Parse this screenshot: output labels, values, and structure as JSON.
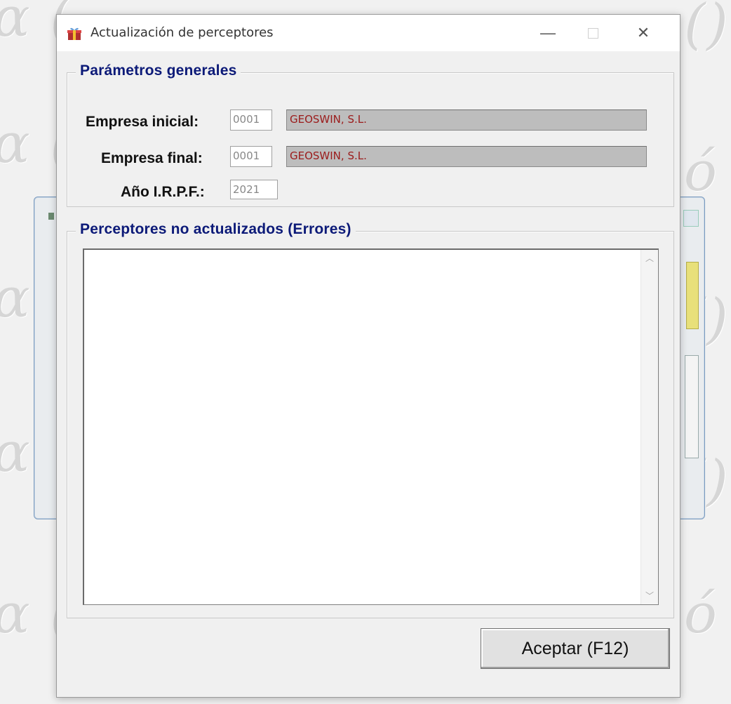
{
  "window": {
    "title": "Actualización de perceptores",
    "minimize_icon": "minimize-icon",
    "maximize_icon": "maximize-icon",
    "close_icon": "close-icon",
    "app_icon": "gift-box-icon"
  },
  "general_params": {
    "legend": "Parámetros generales",
    "empresa_inicial_label": "Empresa inicial:",
    "empresa_inicial_code": "0001",
    "empresa_inicial_name": "GEOSWIN, S.L.",
    "empresa_final_label": "Empresa final:",
    "empresa_final_code": "0001",
    "empresa_final_name": "GEOSWIN, S.L.",
    "anio_label": "Año I.R.P.F.:",
    "anio_value": "2021"
  },
  "errors": {
    "legend": "Perceptores no actualizados (Errores)",
    "items": []
  },
  "actions": {
    "accept_label": "Aceptar (F12)"
  },
  "colors": {
    "legend_text": "#0c1a78",
    "name_field_bg": "#bdbdbd",
    "name_field_text": "#9b1b1b"
  }
}
